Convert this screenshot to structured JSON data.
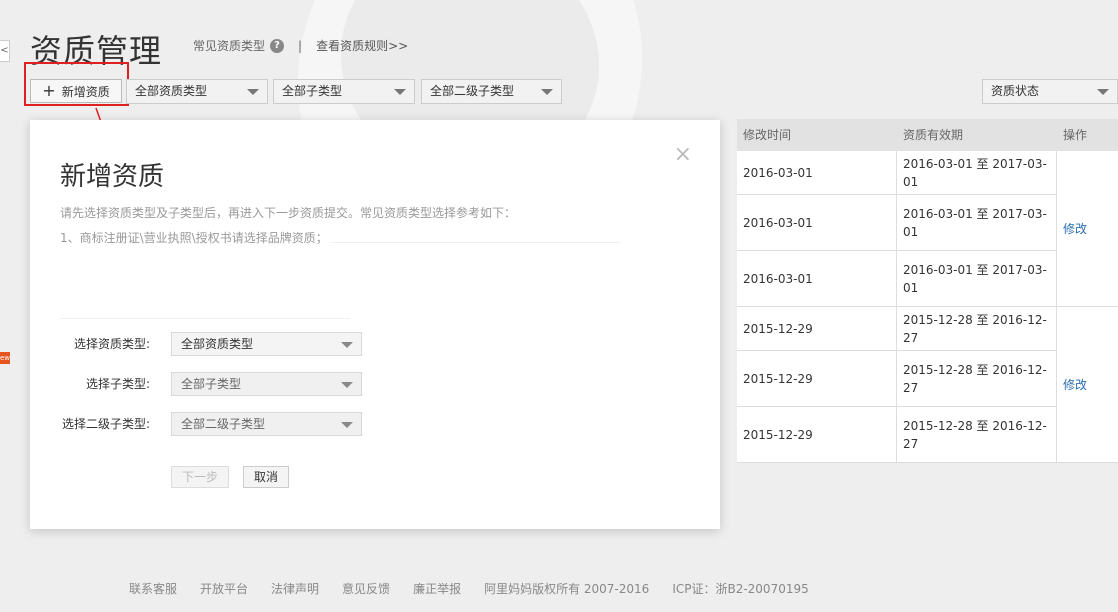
{
  "page": {
    "title": "资质管理",
    "common_types_link": "常见资质类型",
    "separator": "|",
    "rules_link": "查看资质规则>>",
    "side_tab_glyph": "<",
    "side_badge": "ew"
  },
  "toolbar": {
    "add_button_label": "新增资质",
    "add_button_glyph": "+",
    "filter_type": "全部资质类型",
    "filter_subtype": "全部子类型",
    "filter_subtype2": "全部二级子类型",
    "filter_status": "资质状态"
  },
  "table": {
    "headers": [
      "修改时间",
      "资质有效期",
      "操作"
    ],
    "rows": [
      {
        "modified": "2016-03-01",
        "validity": "2016-03-01 至 2017-03-01"
      },
      {
        "modified": "2016-03-01",
        "validity": "2016-03-01 至 2017-03-01"
      },
      {
        "modified": "2016-03-01",
        "validity": "2016-03-01 至 2017-03-01"
      },
      {
        "modified": "2015-12-29",
        "validity": "2015-12-28 至 2016-12-27"
      },
      {
        "modified": "2015-12-29",
        "validity": "2015-12-28 至 2016-12-27"
      },
      {
        "modified": "2015-12-29",
        "validity": "2015-12-28 至 2016-12-27"
      }
    ],
    "edit_label": "修改"
  },
  "modal": {
    "close_glyph": "×",
    "title": "新增资质",
    "description": "请先选择资质类型及子类型后，再进入下一步资质提交。常见资质类型选择参考如下：",
    "note": "1、商标注册证\\营业执照\\授权书请选择品牌资质；",
    "label_type": "选择资质类型:",
    "label_subtype": "选择子类型:",
    "label_subtype2": "选择二级子类型:",
    "value_type": "全部资质类型",
    "value_subtype": "全部子类型",
    "value_subtype2": "全部二级子类型",
    "next_button": "下一步",
    "cancel_button": "取消"
  },
  "footer": {
    "links": [
      "联系客服",
      "开放平台",
      "法律声明",
      "意见反馈",
      "廉正举报",
      "阿里妈妈版权所有 2007-2016",
      "ICP证：浙B2-20070195"
    ]
  },
  "colors": {
    "link_blue": "#2b6db3",
    "highlight_red": "#e02020"
  }
}
